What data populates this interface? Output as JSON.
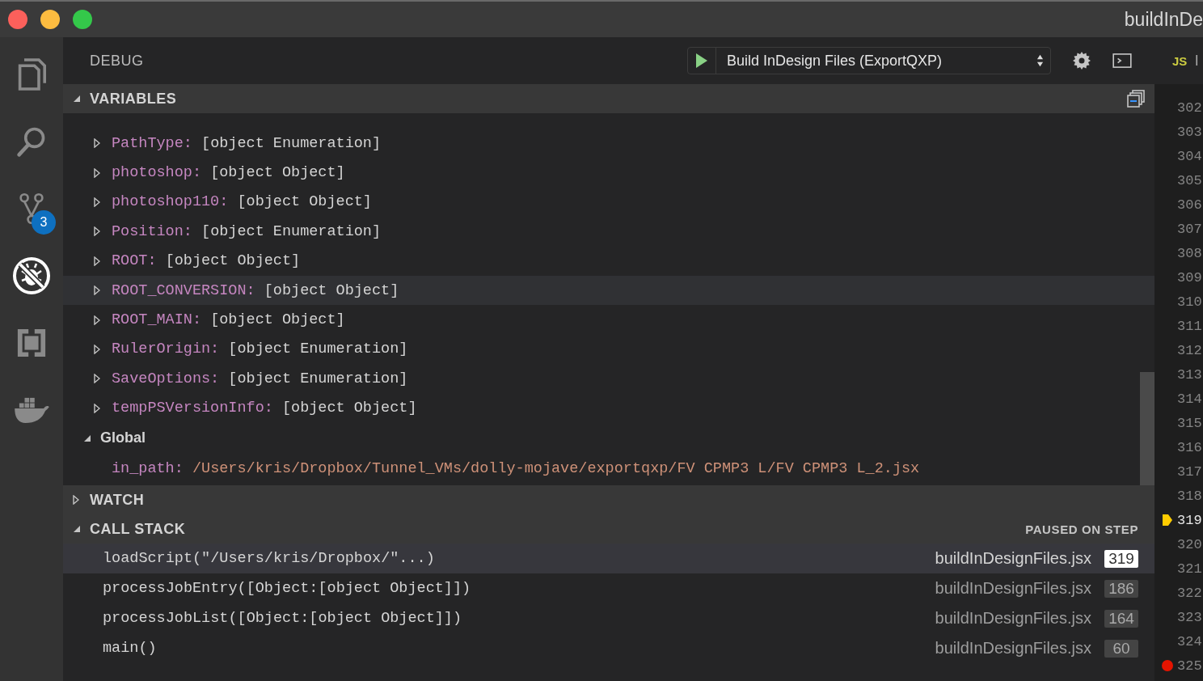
{
  "window": {
    "title": "buildInDe"
  },
  "activity_bar": [
    {
      "selected": false
    },
    {
      "selected": false
    },
    {
      "selected": false,
      "badge": "3"
    },
    {
      "selected": true
    },
    {
      "selected": false
    },
    {
      "selected": false
    }
  ],
  "debug": {
    "title": "DEBUG",
    "configuration": "Build InDesign Files (ExportQXP)"
  },
  "variables": {
    "title": "VARIABLES",
    "expanded": true,
    "items": [
      {
        "name": "PathType:",
        "value": "[object Enumeration]",
        "expandable": true,
        "hovered": false
      },
      {
        "name": "photoshop:",
        "value": "[object Object]",
        "expandable": true,
        "hovered": false
      },
      {
        "name": "photoshop110:",
        "value": "[object Object]",
        "expandable": true,
        "hovered": false
      },
      {
        "name": "Position:",
        "value": "[object Enumeration]",
        "expandable": true,
        "hovered": false
      },
      {
        "name": "ROOT:",
        "value": "[object Object]",
        "expandable": true,
        "hovered": false
      },
      {
        "name": "ROOT_CONVERSION:",
        "value": "[object Object]",
        "expandable": true,
        "hovered": true
      },
      {
        "name": "ROOT_MAIN:",
        "value": "[object Object]",
        "expandable": true,
        "hovered": false
      },
      {
        "name": "RulerOrigin:",
        "value": "[object Enumeration]",
        "expandable": true,
        "hovered": false
      },
      {
        "name": "SaveOptions:",
        "value": "[object Enumeration]",
        "expandable": true,
        "hovered": false
      },
      {
        "name": "tempPSVersionInfo:",
        "value": "[object Object]",
        "expandable": true,
        "hovered": false
      }
    ],
    "scopes": [
      {
        "label": "Global",
        "expanded": true,
        "children": [
          {
            "name": "in_path:",
            "value": "/Users/kris/Dropbox/Tunnel_VMs/dolly-mojave/exportqxp/FV CPMP3 L/FV CPMP3 L_2.jsx",
            "kind": "string",
            "expandable": false,
            "hovered": false
          }
        ]
      }
    ]
  },
  "watch": {
    "title": "WATCH",
    "expanded": false
  },
  "call_stack": {
    "title": "CALL STACK",
    "expanded": true,
    "status": "PAUSED ON STEP",
    "frames": [
      {
        "name": "loadScript(\"/Users/kris/Dropbox/\"...)",
        "file": "buildInDesignFiles.jsx",
        "line": "319",
        "selected": true
      },
      {
        "name": "processJobEntry([Object:[object Object]])",
        "file": "buildInDesignFiles.jsx",
        "line": "186",
        "selected": false
      },
      {
        "name": "processJobList([Object:[object Object]])",
        "file": "buildInDesignFiles.jsx",
        "line": "164",
        "selected": false
      },
      {
        "name": "main()",
        "file": "buildInDesignFiles.jsx",
        "line": "60",
        "selected": false
      }
    ]
  },
  "editor": {
    "tab": {
      "icon": "JS",
      "label": "l"
    },
    "lines": [
      {
        "number": "302"
      },
      {
        "number": "303"
      },
      {
        "number": "304"
      },
      {
        "number": "305"
      },
      {
        "number": "306"
      },
      {
        "number": "307"
      },
      {
        "number": "308"
      },
      {
        "number": "309"
      },
      {
        "number": "310"
      },
      {
        "number": "311"
      },
      {
        "number": "312"
      },
      {
        "number": "313"
      },
      {
        "number": "314"
      },
      {
        "number": "315"
      },
      {
        "number": "316"
      },
      {
        "number": "317"
      },
      {
        "number": "318"
      },
      {
        "number": "319",
        "kind": "current"
      },
      {
        "number": "320"
      },
      {
        "number": "321"
      },
      {
        "number": "322"
      },
      {
        "number": "323"
      },
      {
        "number": "324"
      },
      {
        "number": "325",
        "kind": "breakpoint"
      }
    ]
  }
}
